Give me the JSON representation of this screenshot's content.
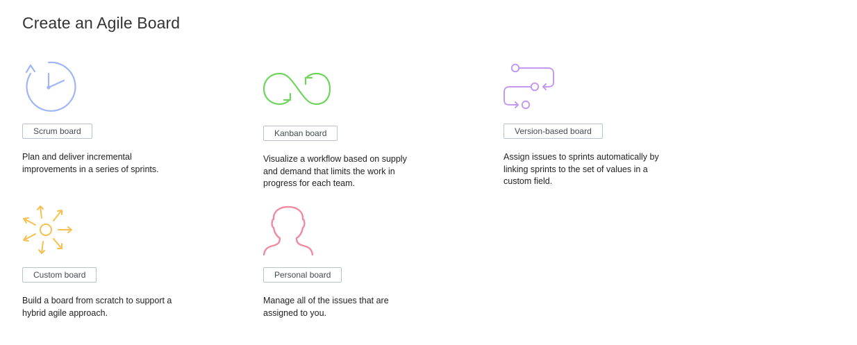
{
  "page": {
    "title": "Create an Agile Board"
  },
  "boards": [
    {
      "id": "scrum",
      "button_label": "Scrum board",
      "description": "Plan and deliver incremental improvements in a series of sprints.",
      "icon": "clock-icon",
      "color": "#9fb6f5"
    },
    {
      "id": "kanban",
      "button_label": "Kanban board",
      "description": "Visualize a workflow based on supply and demand that limits the work in progress for each team.",
      "icon": "infinity-loop-icon",
      "color": "#6fd45c"
    },
    {
      "id": "version",
      "button_label": "Version-based board",
      "description": "Assign issues to sprints automatically by linking sprints to the set of values in a custom field.",
      "icon": "version-flow-icon",
      "color": "#c39af0"
    },
    {
      "id": "custom",
      "button_label": "Custom board",
      "description": "Build a board from scratch to support a hybrid agile approach.",
      "icon": "sun-arrows-icon",
      "color": "#f6c04f"
    },
    {
      "id": "personal",
      "button_label": "Personal board",
      "description": "Manage all of the issues that are assigned to you.",
      "icon": "person-icon",
      "color": "#ee8ba0"
    }
  ]
}
